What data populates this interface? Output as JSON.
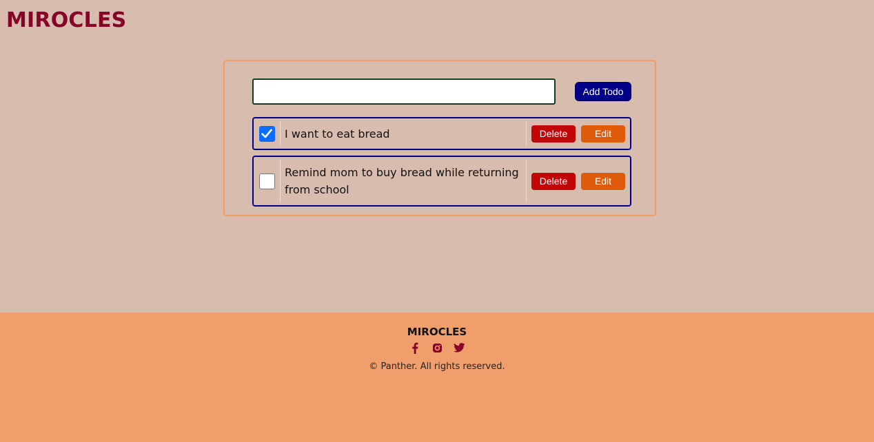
{
  "header": {
    "brand": "MIROCLES",
    "brand_color": "#850427"
  },
  "todo_form": {
    "input_value": "",
    "input_placeholder": "",
    "add_label": "Add Todo"
  },
  "todos": [
    {
      "text": "I want to eat bread",
      "completed": true,
      "delete_label": "Delete",
      "edit_label": "Edit"
    },
    {
      "text": "Remind mom to buy bread while returning from school",
      "completed": false,
      "delete_label": "Delete",
      "edit_label": "Edit"
    }
  ],
  "footer": {
    "brand": "MIROCLES",
    "social_icons": [
      "facebook-icon",
      "instagram-icon",
      "twitter-icon"
    ],
    "copyright": "© Panther. All rights reserved."
  },
  "colors": {
    "page_background": "#d8bcad",
    "footer_background": "#f19e6d",
    "card_border": "#ef9c69",
    "item_border": "#000088",
    "add_button": "#000088",
    "delete_button": "#c00606",
    "edit_button": "#df5b0a",
    "checkbox_checked": "#0b6cff"
  }
}
